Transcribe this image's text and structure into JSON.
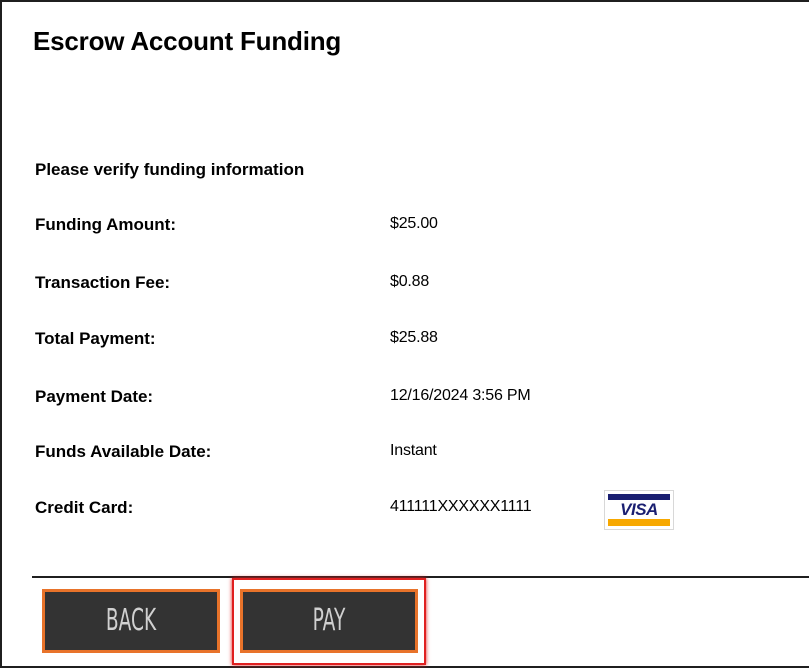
{
  "page": {
    "title": "Escrow Account Funding"
  },
  "form": {
    "prompt": "Please verify funding information",
    "rows": [
      {
        "label": "Funding Amount:",
        "value": "$25.00"
      },
      {
        "label": "Transaction Fee:",
        "value": "$0.88"
      },
      {
        "label": "Total Payment:",
        "value": "$25.88"
      },
      {
        "label": "Payment Date:",
        "value": "12/16/2024 3:56 PM"
      },
      {
        "label": "Funds Available Date:",
        "value": "Instant"
      },
      {
        "label": "Credit Card:",
        "value": "411111XXXXXX1111"
      }
    ],
    "card_brand": "VISA"
  },
  "buttons": {
    "back": "BACK",
    "pay": "PAY"
  },
  "colors": {
    "button_bg": "#333333",
    "button_border": "#e8732a",
    "highlight": "#e02020",
    "visa_blue": "#1a1f71",
    "visa_gold": "#f7a800"
  }
}
